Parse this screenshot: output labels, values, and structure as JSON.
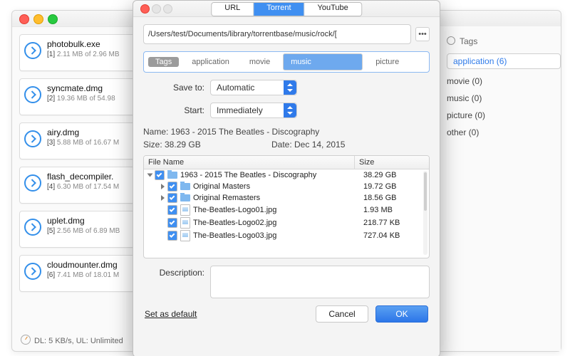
{
  "main_window": {
    "downloads": [
      {
        "name": "photobulk.exe",
        "idx": "[1]",
        "progress": "2.11 MB of 2.96 MB"
      },
      {
        "name": "syncmate.dmg",
        "idx": "[2]",
        "progress": "19.36 MB of 54.98"
      },
      {
        "name": "airy.dmg",
        "idx": "[3]",
        "progress": "5.88 MB of 16.67 M"
      },
      {
        "name": "flash_decompiler.",
        "idx": "[4]",
        "progress": "6.30 MB of 17.54 M"
      },
      {
        "name": "uplet.dmg",
        "idx": "[5]",
        "progress": "2.56 MB of 6.89 MB"
      },
      {
        "name": "cloudmounter.dmg",
        "idx": "[6]",
        "progress": "7.41 MB of 18.01 M"
      }
    ],
    "status": "DL: 5 KB/s, UL: Unlimited",
    "tags_header": "Tags",
    "tags": [
      {
        "label": "application  (6)",
        "selected": true
      },
      {
        "label": "movie  (0)",
        "selected": false
      },
      {
        "label": "music  (0)",
        "selected": false
      },
      {
        "label": "picture  (0)",
        "selected": false
      },
      {
        "label": "other  (0)",
        "selected": false
      }
    ]
  },
  "modal": {
    "tabs": {
      "a": "URL",
      "b": "Torrent",
      "c": "YouTube"
    },
    "path": "/Users/test/Documents/library/torrentbase/music/rock/[",
    "tag_label": "Tags",
    "tag_opts": {
      "a": "application",
      "b": "movie",
      "c": "music",
      "d": "picture"
    },
    "save_to_label": "Save to:",
    "save_to_value": "Automatic",
    "start_label": "Start:",
    "start_value": "Immediately",
    "name_line": "Name:  1963 - 2015 The Beatles - Discography",
    "size_line": "Size: 38.29 GB",
    "date_line": "Date: Dec 14, 2015",
    "col_name": "File Name",
    "col_size": "Size",
    "files": [
      {
        "indent": 0,
        "expand": "down",
        "type": "folder",
        "name": "1963 - 2015 The Beatles - Discography",
        "size": "38.29 GB"
      },
      {
        "indent": 1,
        "expand": "right",
        "type": "folder",
        "name": "Original Masters",
        "size": "19.72 GB"
      },
      {
        "indent": 1,
        "expand": "right",
        "type": "folder",
        "name": "Original Remasters",
        "size": "18.56 GB"
      },
      {
        "indent": 1,
        "expand": "",
        "type": "file",
        "name": "The-Beatles-Logo01.jpg",
        "size": "1.93 MB"
      },
      {
        "indent": 1,
        "expand": "",
        "type": "file",
        "name": "The-Beatles-Logo02.jpg",
        "size": "218.77 KB"
      },
      {
        "indent": 1,
        "expand": "",
        "type": "file",
        "name": "The-Beatles-Logo03.jpg",
        "size": "727.04 KB"
      }
    ],
    "desc_label": "Description:",
    "set_default": "Set as default",
    "cancel": "Cancel",
    "ok": "OK"
  }
}
